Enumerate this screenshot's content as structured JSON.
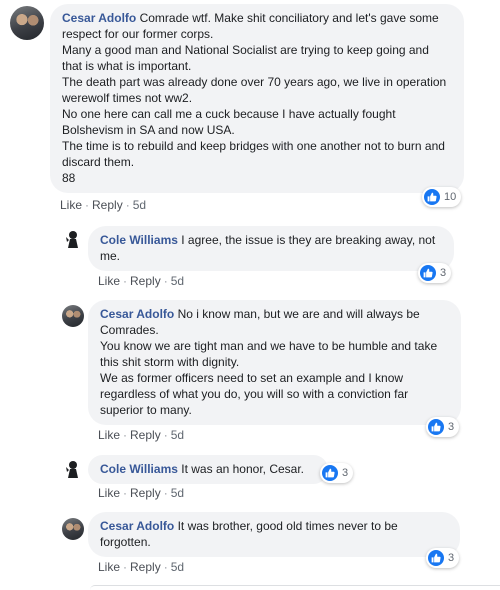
{
  "comments": [
    {
      "author": "Cesar Adolfo",
      "lines": [
        "Comrade wtf. Make shit conciliatory and let's gave some respect for our former corps.",
        "Many a good man and National Socialist are trying to keep going and that is what is important.",
        "The death part was already done over 70 years ago, we live in operation werewolf times not ww2.",
        "No one here can call me a cuck because I have actually fought Bolshevism in SA and now USA.",
        "The time is to rebuild and keep bridges with one another not to burn and discard them.",
        "88"
      ],
      "like": "Like",
      "reply": "Reply",
      "time": "5d",
      "reactions": "10"
    },
    {
      "author": "Cole Williams",
      "lines": [
        "I agree, the issue is they are breaking away, not me."
      ],
      "like": "Like",
      "reply": "Reply",
      "time": "5d",
      "reactions": "3"
    },
    {
      "author": "Cesar Adolfo",
      "lines": [
        "No i know man, but we are and will always be Comrades.",
        "You know we are tight man and we have to be humble and take this shit storm with dignity.",
        "We as former officers need to set an example and I know regardless of what you do, you will so with a conviction far superior to many."
      ],
      "like": "Like",
      "reply": "Reply",
      "time": "5d",
      "reactions": "3"
    },
    {
      "author": "Cole Williams",
      "lines": [
        "It was an honor, Cesar."
      ],
      "like": "Like",
      "reply": "Reply",
      "time": "5d",
      "reactions": "3"
    },
    {
      "author": "Cesar Adolfo",
      "lines": [
        "It was brother, good old times never to be forgotten."
      ],
      "like": "Like",
      "reply": "Reply",
      "time": "5d",
      "reactions": "3"
    }
  ]
}
